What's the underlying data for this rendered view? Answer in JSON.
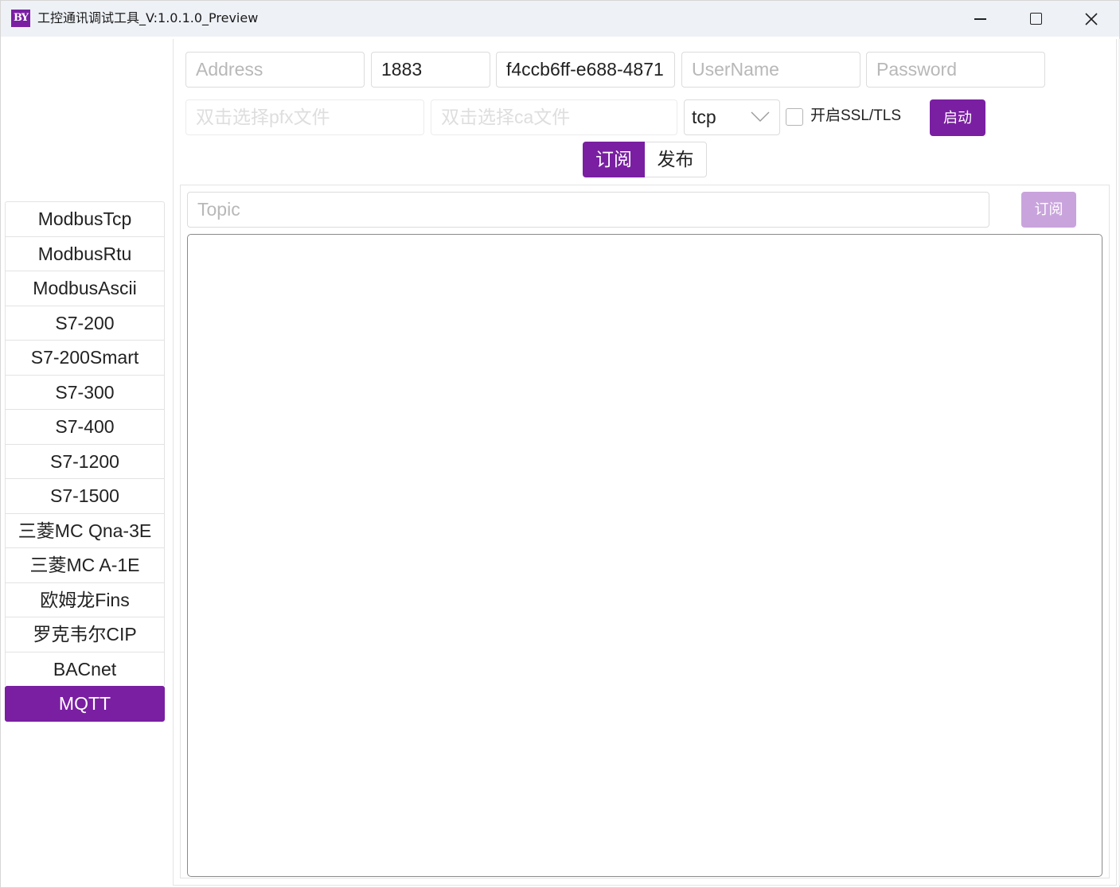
{
  "window": {
    "logo_text": "BY",
    "title": "工控通讯调试工具_V:1.0.1.0_Preview"
  },
  "sidebar": {
    "items": [
      {
        "label": "ModbusTcp",
        "active": false
      },
      {
        "label": "ModbusRtu",
        "active": false
      },
      {
        "label": "ModbusAscii",
        "active": false
      },
      {
        "label": "S7-200",
        "active": false
      },
      {
        "label": "S7-200Smart",
        "active": false
      },
      {
        "label": "S7-300",
        "active": false
      },
      {
        "label": "S7-400",
        "active": false
      },
      {
        "label": "S7-1200",
        "active": false
      },
      {
        "label": "S7-1500",
        "active": false
      },
      {
        "label": "三菱MC Qna-3E",
        "active": false
      },
      {
        "label": "三菱MC A-1E",
        "active": false
      },
      {
        "label": "欧姆龙Fins",
        "active": false
      },
      {
        "label": "罗克韦尔CIP",
        "active": false
      },
      {
        "label": "BACnet",
        "active": false
      },
      {
        "label": "MQTT",
        "active": true
      }
    ]
  },
  "connection": {
    "address_placeholder": "Address",
    "address_value": "",
    "port_value": "1883",
    "client_id_value": "f4ccb6ff-e688-4871",
    "username_placeholder": "UserName",
    "username_value": "",
    "password_placeholder": "Password",
    "password_value": "",
    "pfx_placeholder": "双击选择pfx文件",
    "ca_placeholder": "双击选择ca文件",
    "protocol_selected": "tcp",
    "ssl_label": "开启SSL/TLS",
    "ssl_checked": false,
    "start_label": "启动"
  },
  "tabs": [
    {
      "label": "订阅",
      "active": true
    },
    {
      "label": "发布",
      "active": false
    }
  ],
  "subscribe": {
    "topic_placeholder": "Topic",
    "topic_value": "",
    "subscribe_label": "订阅",
    "log_text": ""
  },
  "colors": {
    "accent": "#7a1fa2",
    "accent_disabled": "#c9a4dc"
  }
}
